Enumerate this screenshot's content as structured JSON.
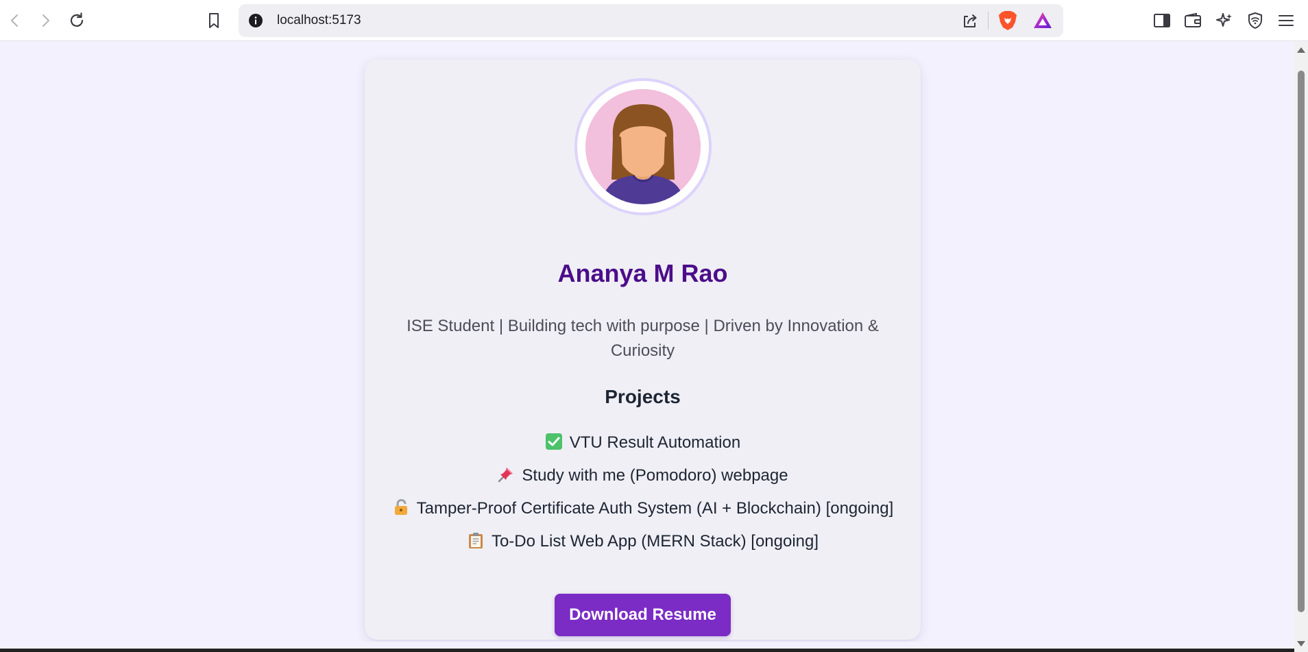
{
  "browser": {
    "url": "localhost:5173",
    "icons": {
      "back": "back-arrow-icon",
      "forward": "forward-arrow-icon",
      "reload": "reload-icon",
      "bookmark": "bookmark-icon",
      "site_info": "info-icon",
      "share": "share-icon",
      "brave_shields": "brave-lion-icon",
      "brave_rewards": "brave-rewards-triangle-icon",
      "sidebar": "sidebar-icon",
      "wallet": "wallet-icon",
      "leo_ai": "sparkle-ai-icon",
      "vpn": "vpn-shield-icon",
      "menu": "hamburger-menu-icon"
    }
  },
  "profile": {
    "name": "Ananya M Rao",
    "bio": "ISE Student | Building tech with purpose | Driven by Innovation & Curiosity",
    "avatar_icon": "female-avatar-illustration"
  },
  "projects": {
    "heading": "Projects",
    "items": [
      {
        "icon": "check-mark-emoji-icon",
        "label": "VTU Result Automation"
      },
      {
        "icon": "pushpin-emoji-icon",
        "label": "Study with me (Pomodoro) webpage"
      },
      {
        "icon": "lock-emoji-icon",
        "label": "Tamper-Proof Certificate Auth System (AI + Blockchain) [ongoing]"
      },
      {
        "icon": "clipboard-emoji-icon",
        "label": "To-Do List Web App (MERN Stack) [ongoing]"
      }
    ]
  },
  "actions": {
    "download_label": "Download Resume"
  },
  "colors": {
    "page_bg": "#f3f1fd",
    "card_bg": "#efeff5",
    "name": "#4c0d8a",
    "button_bg": "#7b2cc4",
    "avatar_bg": "#f2bfdc",
    "avatar_ring": "#ddd3fb"
  }
}
